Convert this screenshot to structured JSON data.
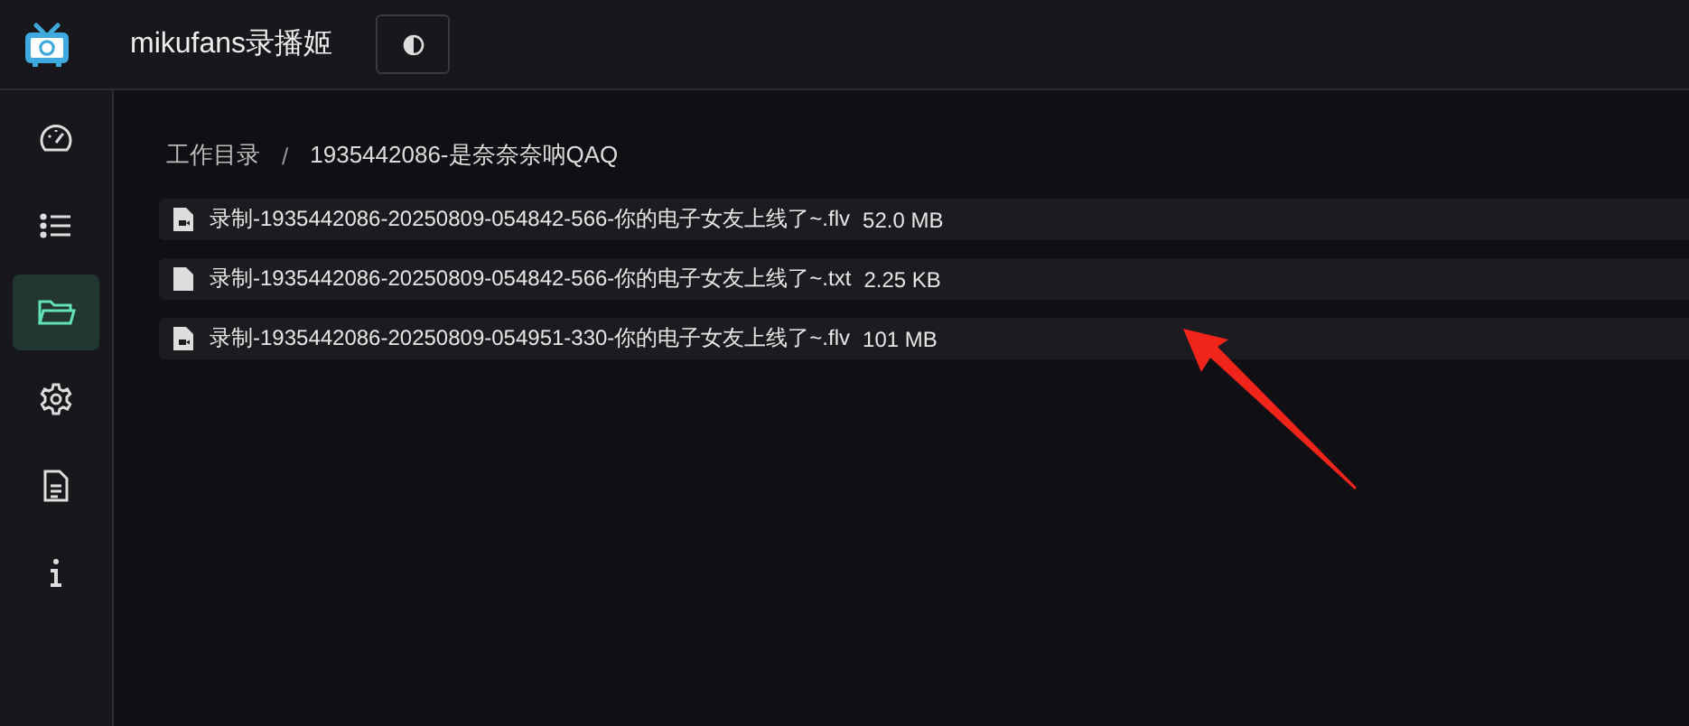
{
  "header": {
    "title": "mikufans录播姬"
  },
  "sidebar": {
    "items": [
      {
        "kind": "dashboard",
        "selected": false
      },
      {
        "kind": "list",
        "selected": false
      },
      {
        "kind": "folder",
        "selected": true
      },
      {
        "kind": "settings",
        "selected": false
      },
      {
        "kind": "document",
        "selected": false
      },
      {
        "kind": "info",
        "selected": false
      }
    ]
  },
  "breadcrumb": [
    "工作目录",
    "/",
    "1935442086-是奈奈奈呐QAQ"
  ],
  "files": [
    {
      "kind": "video",
      "name": "录制-1935442086-20250809-054842-566-你的电子女友上线了~.flv",
      "size": "52.0 MB"
    },
    {
      "kind": "text",
      "name": "录制-1935442086-20250809-054842-566-你的电子女友上线了~.txt",
      "size": "2.25 KB"
    },
    {
      "kind": "video",
      "name": "录制-1935442086-20250809-054951-330-你的电子女友上线了~.flv",
      "size": "101 MB"
    }
  ]
}
